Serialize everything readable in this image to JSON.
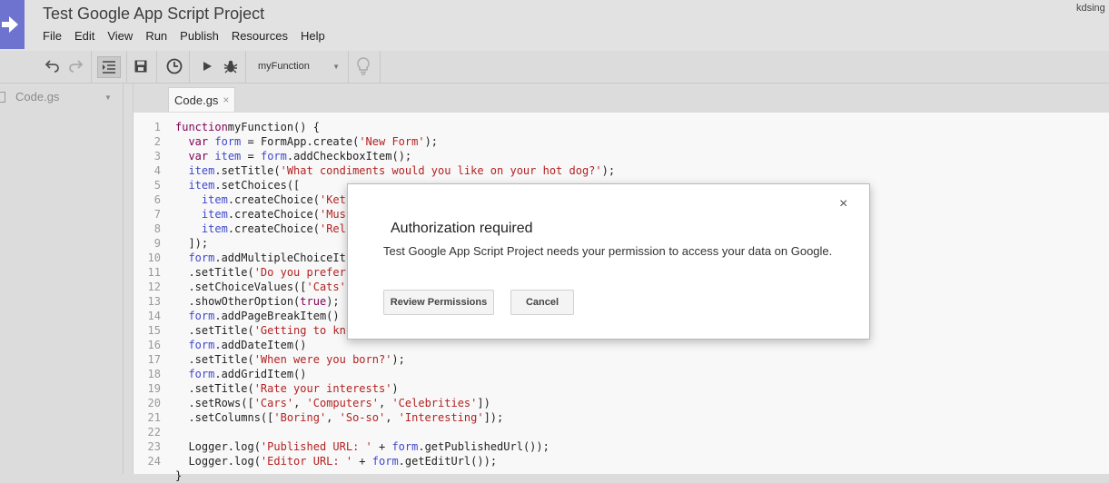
{
  "app": {
    "title": "Test Google App Script Project",
    "user": "kdsing"
  },
  "menu": [
    "File",
    "Edit",
    "View",
    "Run",
    "Publish",
    "Resources",
    "Help"
  ],
  "toolbar": {
    "function_select": "myFunction",
    "icons": [
      "undo-icon",
      "redo-icon",
      "indent-icon",
      "save-icon",
      "triggers-icon",
      "run-icon",
      "debug-icon",
      "lightbulb-icon"
    ]
  },
  "sidebar": {
    "file": "Code.gs"
  },
  "editor": {
    "tab_label": "Code.gs",
    "tab_close": "×",
    "lines": [
      {
        "n": "1",
        "tokens": [
          [
            "kw",
            "function"
          ],
          [
            "",
            "myFunction() {"
          ]
        ]
      },
      {
        "n": "2",
        "tokens": [
          [
            "",
            "  "
          ],
          [
            "kw",
            "var"
          ],
          [
            "",
            ""
          ],
          [
            "vr",
            "form"
          ],
          [
            "",
            " = FormApp.create("
          ],
          [
            "st",
            "'New Form'"
          ],
          [
            "",
            ");"
          ]
        ]
      },
      {
        "n": "3",
        "tokens": [
          [
            "",
            "  "
          ],
          [
            "kw",
            "var"
          ],
          [
            "",
            ""
          ],
          [
            "vr",
            "item"
          ],
          [
            "",
            " = "
          ],
          [
            "vr",
            "form"
          ],
          [
            "",
            ".addCheckboxItem();"
          ]
        ]
      },
      {
        "n": "4",
        "tokens": [
          [
            "",
            "  "
          ],
          [
            "vr",
            "item"
          ],
          [
            "",
            ".setTitle("
          ],
          [
            "st",
            "'What condiments would you like on your hot dog?'"
          ],
          [
            "",
            ");"
          ]
        ]
      },
      {
        "n": "5",
        "tokens": [
          [
            "",
            "  "
          ],
          [
            "vr",
            "item"
          ],
          [
            "",
            ".setChoices(["
          ]
        ]
      },
      {
        "n": "6",
        "tokens": [
          [
            "",
            "    "
          ],
          [
            "vr",
            "item"
          ],
          [
            "",
            ".createChoice("
          ],
          [
            "st",
            "'Ket"
          ]
        ]
      },
      {
        "n": "7",
        "tokens": [
          [
            "",
            "    "
          ],
          [
            "vr",
            "item"
          ],
          [
            "",
            ".createChoice("
          ],
          [
            "st",
            "'Mus"
          ]
        ]
      },
      {
        "n": "8",
        "tokens": [
          [
            "",
            "    "
          ],
          [
            "vr",
            "item"
          ],
          [
            "",
            ".createChoice("
          ],
          [
            "st",
            "'Rel"
          ]
        ]
      },
      {
        "n": "9",
        "tokens": [
          [
            "",
            "  ]);"
          ]
        ]
      },
      {
        "n": "10",
        "tokens": [
          [
            "",
            "  "
          ],
          [
            "vr",
            "form"
          ],
          [
            "",
            ".addMultipleChoiceIt"
          ]
        ]
      },
      {
        "n": "11",
        "tokens": [
          [
            "",
            "  .setTitle("
          ],
          [
            "st",
            "'Do you prefer"
          ]
        ]
      },
      {
        "n": "12",
        "tokens": [
          [
            "",
            "  .setChoiceValues(["
          ],
          [
            "st",
            "'Cats'"
          ]
        ]
      },
      {
        "n": "13",
        "tokens": [
          [
            "",
            "  .showOtherOption("
          ],
          [
            "kw",
            "true"
          ],
          [
            "",
            ");"
          ]
        ]
      },
      {
        "n": "14",
        "tokens": [
          [
            "",
            "  "
          ],
          [
            "vr",
            "form"
          ],
          [
            "",
            ".addPageBreakItem()"
          ]
        ]
      },
      {
        "n": "15",
        "tokens": [
          [
            "",
            "  .setTitle("
          ],
          [
            "st",
            "'Getting to kn"
          ]
        ]
      },
      {
        "n": "16",
        "tokens": [
          [
            "",
            "  "
          ],
          [
            "vr",
            "form"
          ],
          [
            "",
            ".addDateItem()"
          ]
        ]
      },
      {
        "n": "17",
        "tokens": [
          [
            "",
            "  .setTitle("
          ],
          [
            "st",
            "'When were you born?'"
          ],
          [
            "",
            ");"
          ]
        ]
      },
      {
        "n": "18",
        "tokens": [
          [
            "",
            "  "
          ],
          [
            "vr",
            "form"
          ],
          [
            "",
            ".addGridItem()"
          ]
        ]
      },
      {
        "n": "19",
        "tokens": [
          [
            "",
            "  .setTitle("
          ],
          [
            "st",
            "'Rate your interests'"
          ],
          [
            "",
            ")"
          ]
        ]
      },
      {
        "n": "20",
        "tokens": [
          [
            "",
            "  .setRows(["
          ],
          [
            "st",
            "'Cars'"
          ],
          [
            "",
            ", "
          ],
          [
            "st",
            "'Computers'"
          ],
          [
            "",
            ", "
          ],
          [
            "st",
            "'Celebrities'"
          ],
          [
            "",
            "])"
          ]
        ]
      },
      {
        "n": "21",
        "tokens": [
          [
            "",
            "  .setColumns(["
          ],
          [
            "st",
            "'Boring'"
          ],
          [
            "",
            ", "
          ],
          [
            "st",
            "'So-so'"
          ],
          [
            "",
            ", "
          ],
          [
            "st",
            "'Interesting'"
          ],
          [
            "",
            "]);"
          ]
        ]
      },
      {
        "n": "22",
        "tokens": [
          [
            "",
            ""
          ]
        ]
      },
      {
        "n": "23",
        "tokens": [
          [
            "",
            "  Logger.log("
          ],
          [
            "st",
            "'Published URL: '"
          ],
          [
            "",
            " + "
          ],
          [
            "vr",
            "form"
          ],
          [
            "",
            ".getPublishedUrl());"
          ]
        ]
      },
      {
        "n": "24",
        "tokens": [
          [
            "",
            "  Logger.log("
          ],
          [
            "st",
            "'Editor URL: '"
          ],
          [
            "",
            " + "
          ],
          [
            "vr",
            "form"
          ],
          [
            "",
            ".getEditUrl());"
          ]
        ]
      },
      {
        "n": "",
        "tokens": [
          [
            "",
            "}"
          ]
        ]
      }
    ]
  },
  "dialog": {
    "title": "Authorization required",
    "message": "Test Google App Script Project needs your permission to access your data on Google.",
    "primary_button": "Review Permissions",
    "secondary_button": "Cancel",
    "close": "×"
  }
}
